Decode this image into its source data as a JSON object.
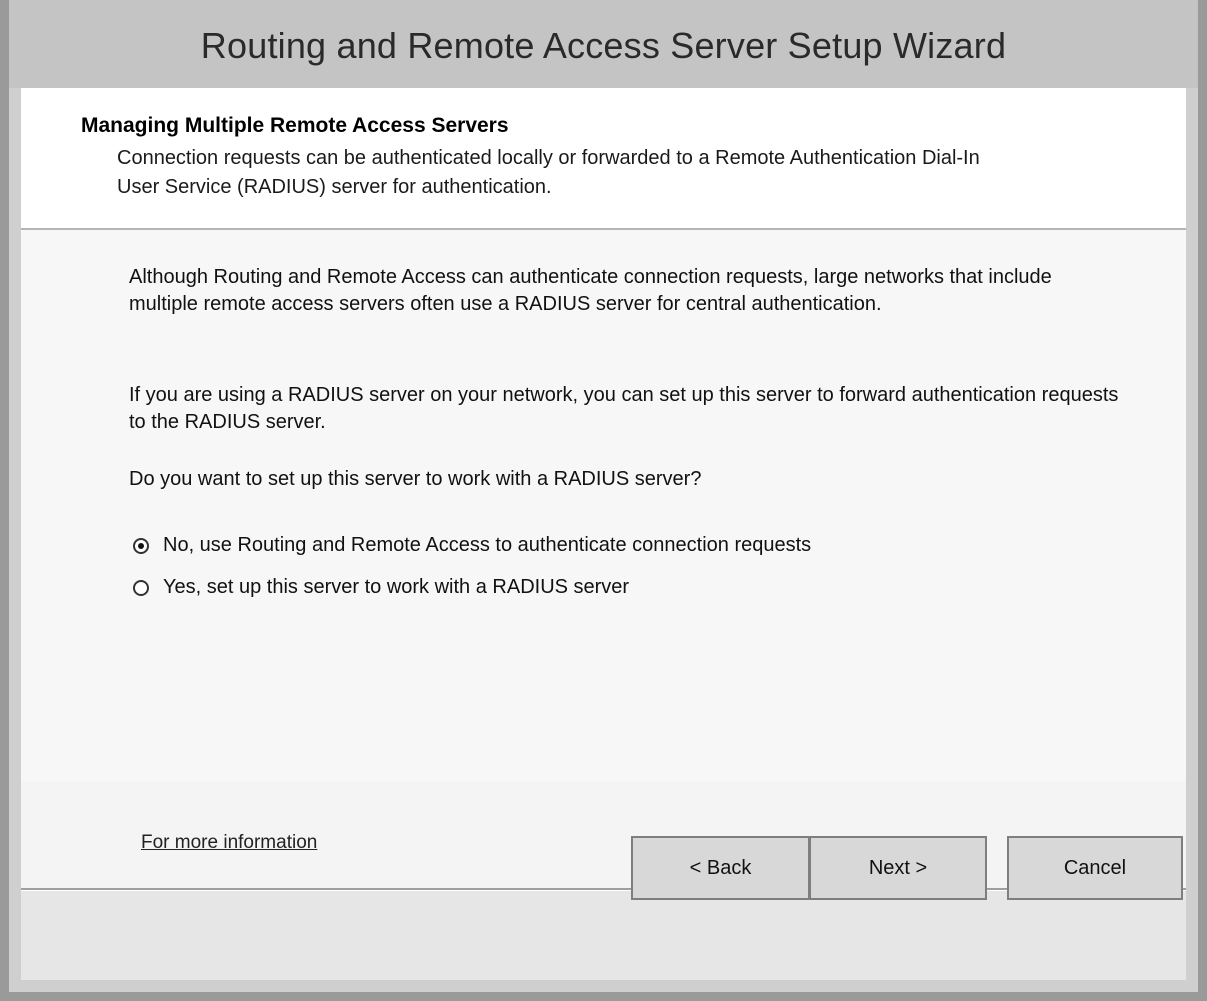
{
  "window": {
    "title": "Routing and Remote Access Server Setup Wizard"
  },
  "header": {
    "title": "Managing Multiple Remote Access Servers",
    "description": "Connection requests can be authenticated locally or forwarded to a Remote Authentication Dial-In User Service (RADIUS) server for authentication."
  },
  "body": {
    "paragraph1": "Although Routing and Remote Access can authenticate connection requests, large networks that include multiple remote access servers often use a RADIUS server for central authentication.",
    "paragraph2": "If you are using a RADIUS server on your network, you can set up this server to forward authentication requests to the RADIUS server.",
    "question": "Do you want to set up this server to work with a RADIUS server?",
    "options": [
      {
        "label": "No, use Routing and Remote Access to authenticate connection requests",
        "selected": true
      },
      {
        "label": "Yes, set up this server to work with a RADIUS server",
        "selected": false
      }
    ],
    "more_info_link": "For more information"
  },
  "buttons": {
    "back": "< Back",
    "next": "Next >",
    "cancel": "Cancel"
  }
}
